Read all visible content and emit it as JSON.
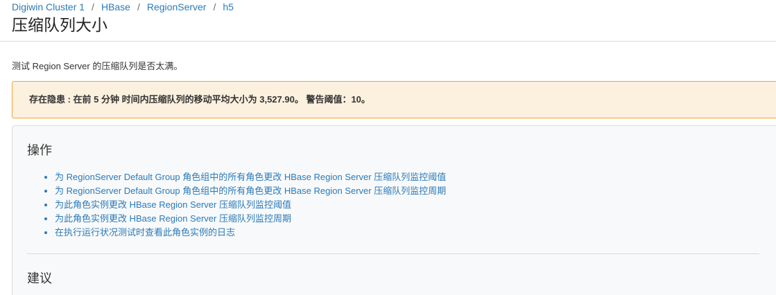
{
  "breadcrumb": {
    "items": [
      "Digiwin Cluster 1",
      "HBase",
      "RegionServer",
      "h5"
    ],
    "separator": "/"
  },
  "page": {
    "title": "压缩队列大小",
    "description": "测试 Region Server 的压缩队列是否太满。"
  },
  "alert": {
    "text": "存在隐患 : 在前 5 分钟 时间内压缩队列的移动平均大小为 3,527.90。 警告阈值：10。"
  },
  "actions": {
    "title": "操作",
    "items": [
      "为 RegionServer Default Group 角色组中的所有角色更改 HBase Region Server 压缩队列监控阈值",
      "为 RegionServer Default Group 角色组中的所有角色更改 HBase Region Server 压缩队列监控周期",
      "为此角色实例更改 HBase Region Server 压缩队列监控阈值",
      "为此角色实例更改 HBase Region Server 压缩队列监控周期",
      "在执行运行状况测试时查看此角色实例的日志"
    ]
  },
  "recommendations": {
    "title": "建议"
  },
  "colors": {
    "link": "#2a7ab8",
    "alert_background": "#fcf0df",
    "alert_border": "#f0a43c",
    "panel_background": "#f8f9fa"
  }
}
